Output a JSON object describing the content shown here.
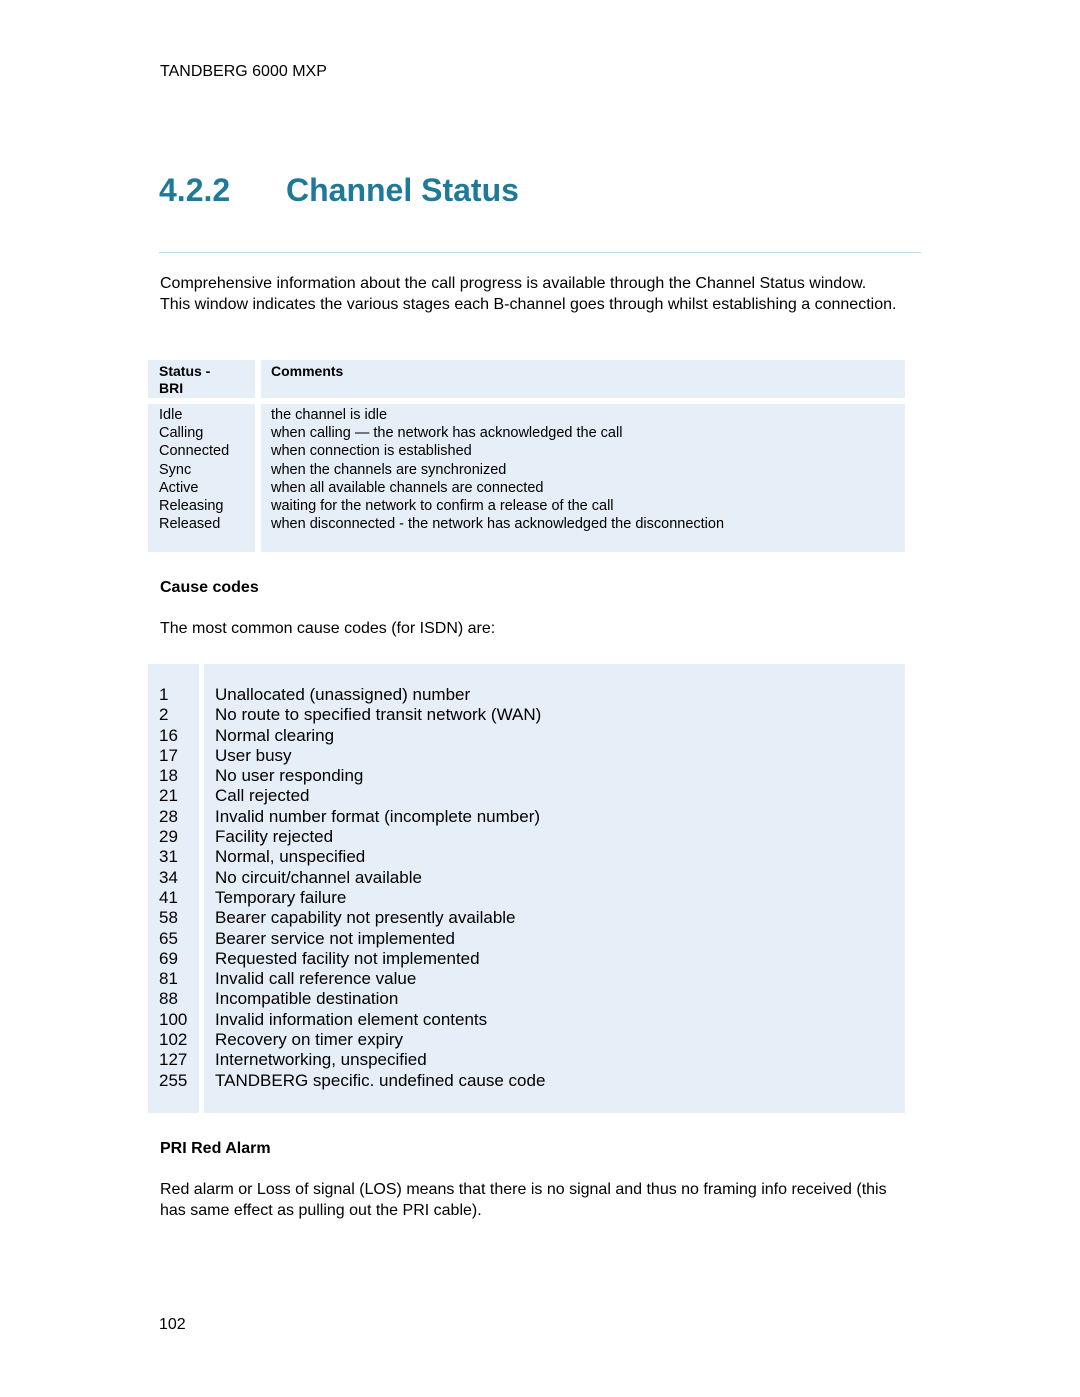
{
  "header": {
    "running_title": "TANDBERG 6000 MXP"
  },
  "section": {
    "number": "4.2.2",
    "title": "Channel Status",
    "intro": "Comprehensive information about the call progress is available through the Channel Status window. This window indicates the various stages each B-channel goes through whilst establishing a connection."
  },
  "status_table": {
    "headers": [
      "Status - BRI",
      "Comments"
    ],
    "rows": [
      {
        "status": "Idle",
        "comment": "the channel is idle"
      },
      {
        "status": "Calling",
        "comment": "when calling — the network has acknowledged the call"
      },
      {
        "status": "Connected",
        "comment": "when connection is established"
      },
      {
        "status": "Sync",
        "comment": "when the channels are synchronized"
      },
      {
        "status": "Active",
        "comment": "when all available channels are connected"
      },
      {
        "status": "Releasing",
        "comment": "waiting for the network to confirm a release of the call"
      },
      {
        "status": "Released",
        "comment": "when disconnected - the network has acknowledged the disconnection"
      }
    ]
  },
  "cause_codes": {
    "heading": "Cause codes",
    "intro": "The most common cause codes (for ISDN) are:",
    "rows": [
      {
        "code": "1",
        "description": "Unallocated (unassigned) number"
      },
      {
        "code": "2",
        "description": "No route to specified transit network (WAN)"
      },
      {
        "code": "16",
        "description": "Normal clearing"
      },
      {
        "code": "17",
        "description": "User busy"
      },
      {
        "code": "18",
        "description": "No user responding"
      },
      {
        "code": "21",
        "description": "Call rejected"
      },
      {
        "code": "28",
        "description": "Invalid number format (incomplete number)"
      },
      {
        "code": "29",
        "description": "Facility rejected"
      },
      {
        "code": "31",
        "description": "Normal, unspecified"
      },
      {
        "code": "34",
        "description": "No circuit/channel available"
      },
      {
        "code": "41",
        "description": "Temporary failure"
      },
      {
        "code": "58",
        "description": "Bearer capability not presently available"
      },
      {
        "code": "65",
        "description": "Bearer service not implemented"
      },
      {
        "code": "69",
        "description": "Requested facility not implemented"
      },
      {
        "code": "81",
        "description": "Invalid call reference value"
      },
      {
        "code": "88",
        "description": "Incompatible destination"
      },
      {
        "code": "100",
        "description": "Invalid information element contents"
      },
      {
        "code": "102",
        "description": "Recovery on timer expiry"
      },
      {
        "code": "127",
        "description": "Internetworking, unspecified"
      },
      {
        "code": "255",
        "description": "TANDBERG specific. undefined cause code"
      }
    ]
  },
  "pri_red_alarm": {
    "heading": "PRI Red Alarm",
    "text": "Red alarm or Loss of signal (LOS) means that there is no signal and thus no framing info received (this has same effect as pulling out the PRI cable)."
  },
  "footer": {
    "page_number": "102"
  },
  "colors": {
    "heading": "#1f7a99",
    "rule": "#bcdce3",
    "table_fill": "#e6eef7"
  }
}
